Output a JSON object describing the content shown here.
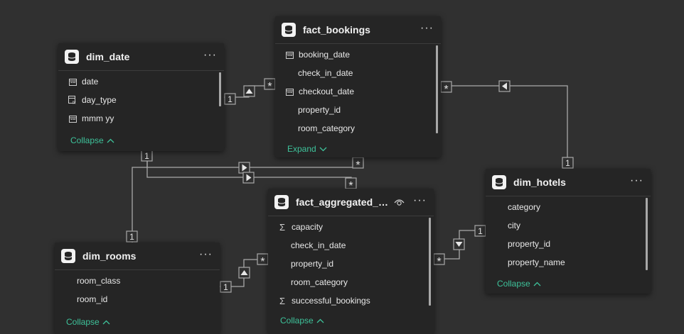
{
  "tables": {
    "dim_date": {
      "title": "dim_date",
      "fields": [
        "date",
        "day_type",
        "mmm yy"
      ],
      "toggle": "Collapse"
    },
    "fact_bookings": {
      "title": "fact_bookings",
      "fields": [
        "booking_date",
        "check_in_date",
        "checkout_date",
        "property_id",
        "room_category"
      ],
      "toggle": "Expand"
    },
    "dim_hotels": {
      "title": "dim_hotels",
      "fields": [
        "category",
        "city",
        "property_id",
        "property_name"
      ],
      "toggle": "Collapse"
    },
    "fact_aggregated": {
      "title": "fact_aggregated_b…",
      "fields": [
        "capacity",
        "check_in_date",
        "property_id",
        "room_category",
        "successful_bookings"
      ],
      "toggle": "Collapse"
    },
    "dim_rooms": {
      "title": "dim_rooms",
      "fields": [
        "room_class",
        "room_id"
      ],
      "toggle": "Collapse"
    }
  },
  "more_label": "···",
  "cardinality": {
    "one": "1",
    "many": "*"
  },
  "colors": {
    "canvas": "#303030",
    "card": "#252525",
    "accent": "#3ec29a",
    "line": "#a9a9a9"
  },
  "icons": {
    "table": "table-icon",
    "calendar": "calendar-icon",
    "calc": "calculated-column-icon",
    "sigma": "sigma-icon",
    "eye": "eye-icon",
    "more": "more-options-icon"
  }
}
